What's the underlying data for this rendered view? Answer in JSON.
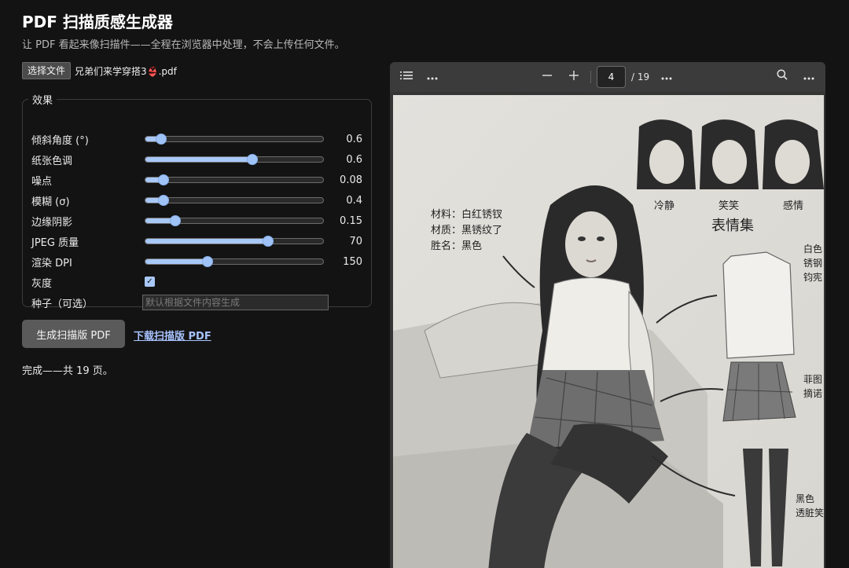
{
  "app": {
    "title": "PDF 扫描质感生成器",
    "subtitle": "让 PDF 看起来像扫描件——全程在浏览器中处理，不会上传任何文件。"
  },
  "file": {
    "button_label": "选择文件",
    "file_name": "兄弟们来学穿搭3👙.pdf"
  },
  "effects": {
    "legend": "效果",
    "sliders": [
      {
        "label": "倾斜角度 (°)",
        "value": "0.6",
        "fraction": 0.09
      },
      {
        "label": "纸张色调",
        "value": "0.6",
        "fraction": 0.6
      },
      {
        "label": "噪点",
        "value": "0.08",
        "fraction": 0.1
      },
      {
        "label": "模糊 (σ)",
        "value": "0.4",
        "fraction": 0.1
      },
      {
        "label": "边缘阴影",
        "value": "0.15",
        "fraction": 0.17
      },
      {
        "label": "JPEG 质量",
        "value": "70",
        "fraction": 0.69
      },
      {
        "label": "渲染 DPI",
        "value": "150",
        "fraction": 0.35
      }
    ],
    "grayscale": {
      "label": "灰度",
      "checked": true,
      "check_glyph": "✓"
    },
    "seed": {
      "label": "种子（可选）",
      "placeholder": "默认根据文件内容生成"
    }
  },
  "actions": {
    "generate_label": "生成扫描版 PDF",
    "download_label": "下载扫描版 PDF"
  },
  "status": "完成——共 19 页。",
  "viewer": {
    "current_page": "4",
    "total_pages": "/ 19",
    "page_text": {
      "material": "材料：白红锈钗",
      "texture": "材质：黑锈纹了",
      "name": "胜名：黑色",
      "face_1": "冷静",
      "face_2": "笑笑",
      "face_3": "感情",
      "faces_title": "表情集",
      "shirt_1": "白色",
      "shirt_2": "锈钢",
      "shirt_3": "钧宪",
      "skirt_1": "菲图",
      "skirt_2": "摘诺",
      "stockings_1": "黑色",
      "stockings_2": "透脏笑"
    }
  }
}
